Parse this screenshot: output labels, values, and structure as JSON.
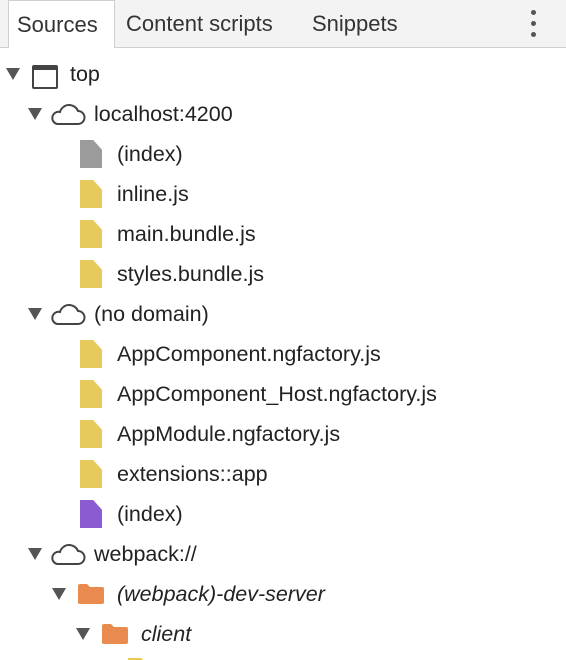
{
  "tabs": [
    {
      "label": "Sources",
      "active": true
    },
    {
      "label": "Content scripts",
      "active": false
    },
    {
      "label": "Snippets",
      "active": false
    }
  ],
  "more_icon": "kebab-menu-icon",
  "colors": {
    "file_script": "#e7c95c",
    "file_document": "#9b9b9b",
    "file_extension": "#8a5bd1",
    "folder": "#e98b4f",
    "tab_bar_bg": "#f3f3f3"
  },
  "tree": {
    "top": {
      "label": "top",
      "icon": "frame-icon",
      "expanded": true
    },
    "localhost": {
      "label": "localhost:4200",
      "icon": "cloud-icon",
      "expanded": true,
      "files": [
        "(index)",
        "inline.js",
        "main.bundle.js",
        "styles.bundle.js"
      ]
    },
    "no_domain": {
      "label": "(no domain)",
      "icon": "cloud-icon",
      "expanded": true,
      "files": [
        "AppComponent.ngfactory.js",
        "AppComponent_Host.ngfactory.js",
        "AppModule.ngfactory.js",
        "extensions::app",
        "(index)"
      ]
    },
    "webpack": {
      "label": "webpack://",
      "icon": "cloud-icon",
      "expanded": true,
      "dev_server": {
        "label": "(webpack)-dev-server",
        "expanded": true
      },
      "client": {
        "label": "client",
        "expanded": true
      }
    }
  }
}
